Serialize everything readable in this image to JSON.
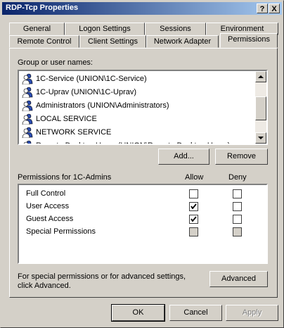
{
  "window": {
    "title": "RDP-Tcp Properties",
    "help_label": "?",
    "close_label": "X"
  },
  "tabs_row_top": [
    {
      "label": "General"
    },
    {
      "label": "Logon Settings"
    },
    {
      "label": "Sessions"
    },
    {
      "label": "Environment"
    }
  ],
  "tabs_row_bottom": [
    {
      "label": "Remote Control"
    },
    {
      "label": "Client Settings"
    },
    {
      "label": "Network Adapter"
    },
    {
      "label": "Permissions",
      "active": true
    }
  ],
  "groups": {
    "label": "Group or user names:",
    "items": [
      {
        "name": "1C-Service (UNION\\1C-Service)",
        "icon": "user-group-icon"
      },
      {
        "name": "1C-Uprav (UNION\\1C-Uprav)",
        "icon": "user-group-icon"
      },
      {
        "name": "Administrators (UNION\\Administrators)",
        "icon": "user-group-icon"
      },
      {
        "name": "LOCAL SERVICE",
        "icon": "user-group-icon"
      },
      {
        "name": "NETWORK SERVICE",
        "icon": "user-group-icon"
      },
      {
        "name": "Remote Desktop Users (UNION\\Remote Desktop Users)",
        "icon": "user-group-icon"
      }
    ]
  },
  "buttons": {
    "add": "Add...",
    "remove": "Remove",
    "advanced": "Advanced",
    "ok": "OK",
    "cancel": "Cancel",
    "apply": "Apply"
  },
  "permissions": {
    "label": "Permissions for 1C-Admins",
    "allow_label": "Allow",
    "deny_label": "Deny",
    "rows": [
      {
        "name": "Full Control",
        "allow": false,
        "deny": false,
        "disabled": false
      },
      {
        "name": "User Access",
        "allow": true,
        "deny": false,
        "disabled": false
      },
      {
        "name": "Guest Access",
        "allow": true,
        "deny": false,
        "disabled": false
      },
      {
        "name": "Special Permissions",
        "allow": false,
        "deny": false,
        "disabled": true
      }
    ]
  },
  "advanced_note": "For special permissions or for advanced settings, click Advanced.",
  "colors": {
    "title_start": "#0a246a",
    "title_end": "#a6caf0",
    "face": "#d4d0c8"
  }
}
